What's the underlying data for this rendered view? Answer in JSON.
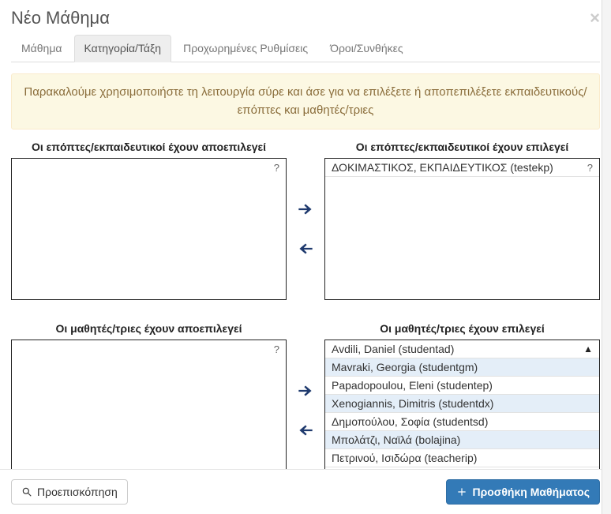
{
  "modal": {
    "title": "Νέο Μάθημα"
  },
  "tabs": {
    "t0": "Μάθημα",
    "t1": "Κατηγορία/Τάξη",
    "t2": "Προχωρημένες Ρυθμίσεις",
    "t3": "Όροι/Συνθήκες"
  },
  "alert": "Παρακαλούμε χρησιμοποιήστε τη λειτουργία σύρε και άσε για να επιλέξετε ή αποπεπιλέξετε εκπαιδευτικούς/επόπτες και μαθητές/τριες",
  "supervisors": {
    "deselected_label": "Οι επόπτες/εκπαιδευτικοί έχουν αποεπιλεγεί",
    "selected_label": "Οι επόπτες/εκπαιδευτικοί έχουν επιλεγεί",
    "selected": [
      {
        "text": "ΔΟΚΙΜΑΣΤΙΚΟΣ, ΕΚΠΑΙΔΕΥΤΙΚΟΣ (testekp)",
        "highlight": false
      }
    ],
    "deselected": []
  },
  "students": {
    "deselected_label": "Οι μαθητές/τριες έχουν αποεπιλεγεί",
    "selected_label": "Οι μαθητές/τριες έχουν επιλεγεί",
    "deselected": [],
    "selected": [
      {
        "text": "Avdili, Daniel (studentad)",
        "highlight": false
      },
      {
        "text": "Mavraki, Georgia (studentgm)",
        "highlight": true
      },
      {
        "text": "Papadopoulou, Eleni (studentep)",
        "highlight": false
      },
      {
        "text": "Xenogiannis, Dimitris (studentdx)",
        "highlight": true
      },
      {
        "text": "Δημοπούλου, Σοφία (studentsd)",
        "highlight": false
      },
      {
        "text": "Μπολάτζι, Ναϊλά (bolajina)",
        "highlight": true
      },
      {
        "text": "Πετρινού, Ισιδώρα (teacherip)",
        "highlight": false
      }
    ]
  },
  "footer": {
    "preview": "Προεπισκόπηση",
    "add": "Προσθήκη Μαθήματος"
  },
  "help": "?",
  "sort": "▲"
}
